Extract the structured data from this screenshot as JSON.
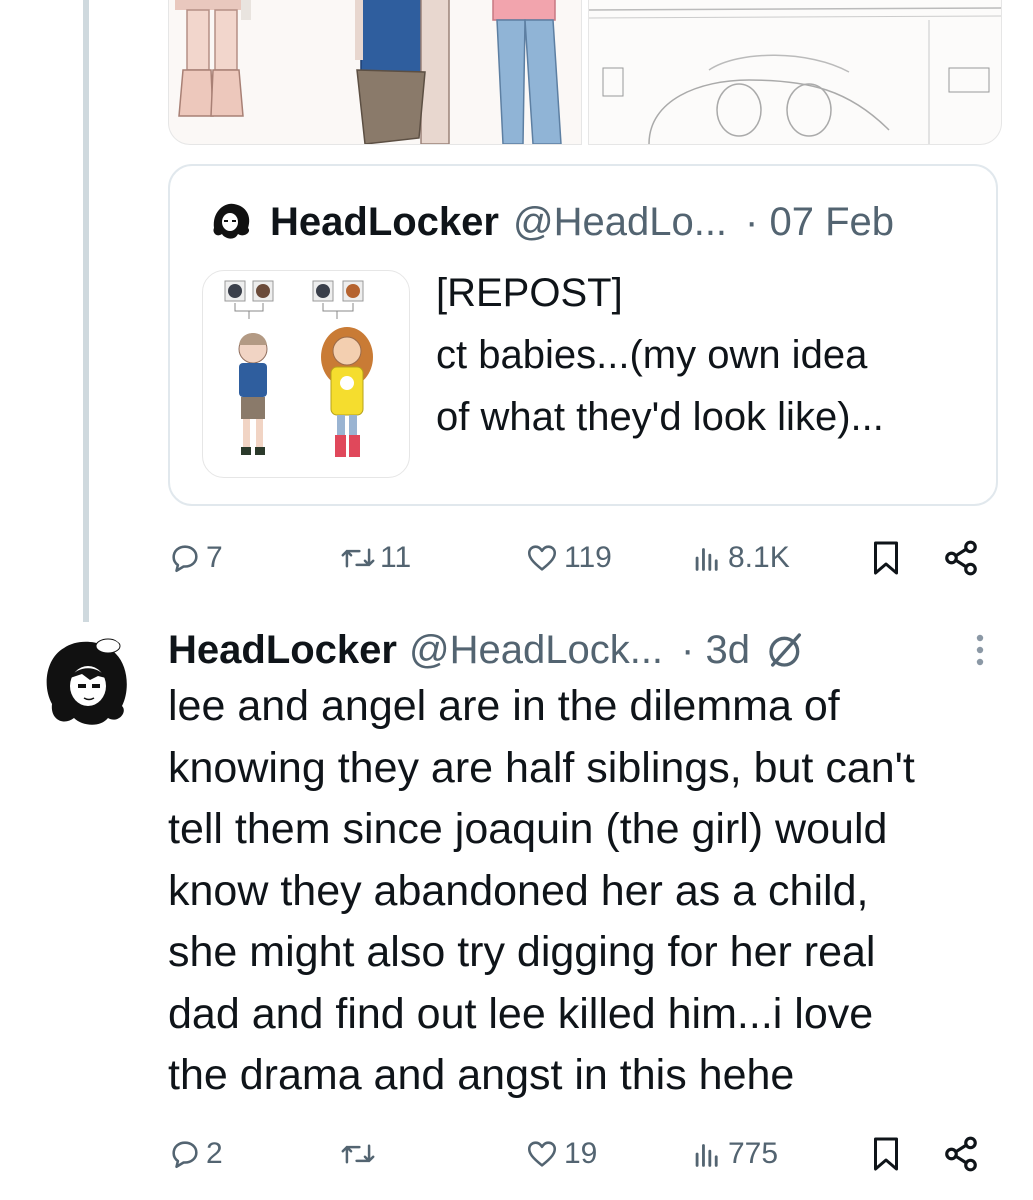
{
  "quoted_tweet": {
    "name": "HeadLocker",
    "handle": "@HeadLo...",
    "date": "· 07 Feb",
    "text_lines": [
      "[REPOST]",
      "ct babies...(my own idea",
      "of what they'd look like)..."
    ],
    "media_thumbnail": "character-designs-thumbnail"
  },
  "first_actions": {
    "replies": "7",
    "reposts": "11",
    "likes": "119",
    "views": "8.1K"
  },
  "main_tweet": {
    "name": "HeadLocker",
    "handle": "@HeadLock...",
    "time": "· 3d",
    "body_lines": [
      "lee and angel are in the dilemma of",
      "knowing they are half siblings, but can't",
      "tell them since joaquin (the girl) would",
      "know they abandoned her as a child,",
      "she might also try digging for her real",
      "dad and find out lee killed him...i love",
      "the drama and angst in this hehe"
    ]
  },
  "second_actions": {
    "replies": "2",
    "reposts": "",
    "likes": "19",
    "views": "775"
  },
  "icons": {
    "reply": "reply-icon",
    "repost": "repost-icon",
    "like": "like-icon",
    "views": "views-icon",
    "bookmark": "bookmark-icon",
    "share": "share-icon",
    "more": "more-icon",
    "no-edit": "circle-slash-icon"
  },
  "colors": {
    "secondary_text": "#536471",
    "primary_text": "#0f1419",
    "border": "#e1e8ed"
  }
}
